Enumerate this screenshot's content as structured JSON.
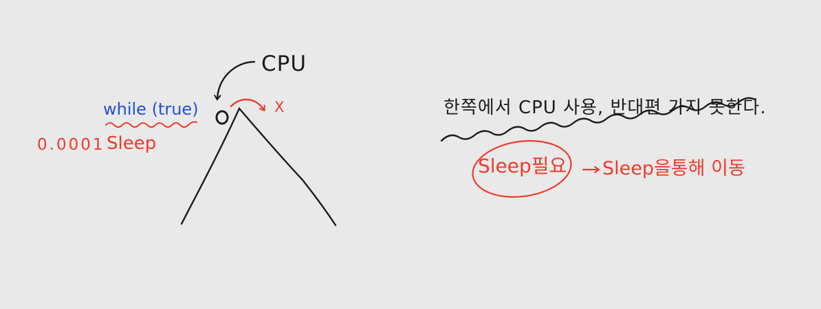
{
  "colors": {
    "background": "#e9e9e9",
    "ink_black": "#1c1c1c",
    "ink_blue": "#2450d8",
    "ink_red": "#ee3a2c"
  },
  "left": {
    "cpu_label": "CPU",
    "loop_label": "while (true)",
    "x_mark": "X",
    "sleep_value": "0.0001",
    "sleep_word": "Sleep"
  },
  "right": {
    "statement": "한쪽에서 CPU 사용, 반대편 가지 못한다.",
    "need_sleep": "Sleep필요",
    "result": "Sleep을통해 이동"
  }
}
